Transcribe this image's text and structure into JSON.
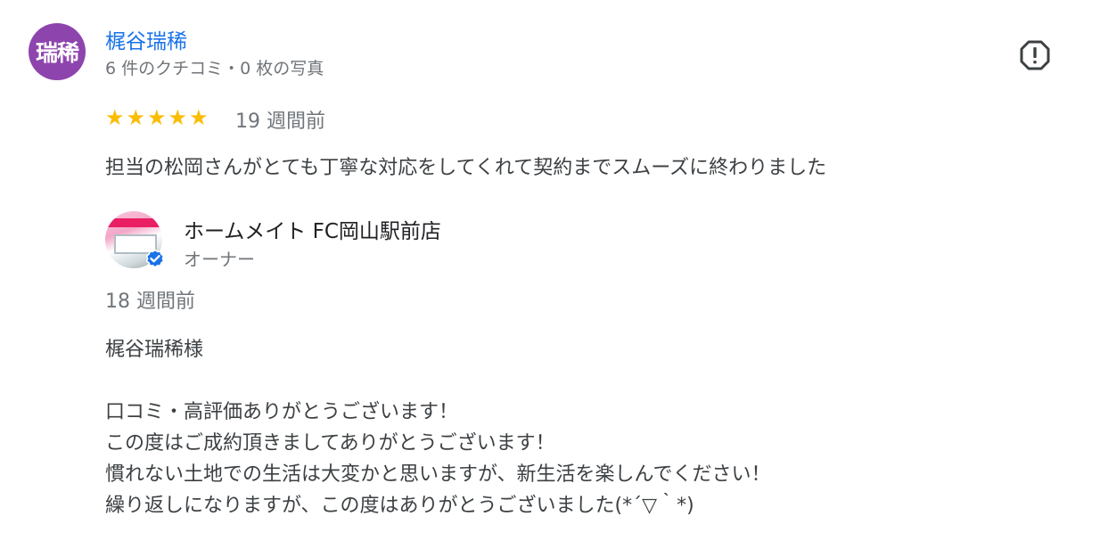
{
  "review": {
    "avatar_text": "瑞稀",
    "avatar_color": "#8e44ad",
    "reviewer_name": "梶谷瑞稀",
    "reviewer_meta": "6 件のクチコミ・0 枚の写真",
    "rating": 5,
    "stars": [
      "★",
      "★",
      "★",
      "★",
      "★"
    ],
    "age": "19 週間前",
    "text": "担当の松岡さんがとても丁寧な対応をしてくれて契約までスムーズに終わりました",
    "report_icon": "report-flag-icon"
  },
  "owner_reply": {
    "owner_name": "ホームメイト FC岡山駅前店",
    "owner_role": "オーナー",
    "age": "18 週間前",
    "lines": [
      "梶谷瑞稀様",
      "",
      "口コミ・高評価ありがとうございます！",
      "この度はご成約頂きましてありがとうございます！",
      "慣れない土地での生活は大変かと思いますが、新生活を楽しんでください！",
      "繰り返しになりますが、この度はありがとうございました(*´▽｀*)"
    ]
  },
  "colors": {
    "link": "#1a73e8",
    "star": "#fbbc04",
    "secondary_text": "#70757a",
    "verified": "#1a73e8"
  }
}
